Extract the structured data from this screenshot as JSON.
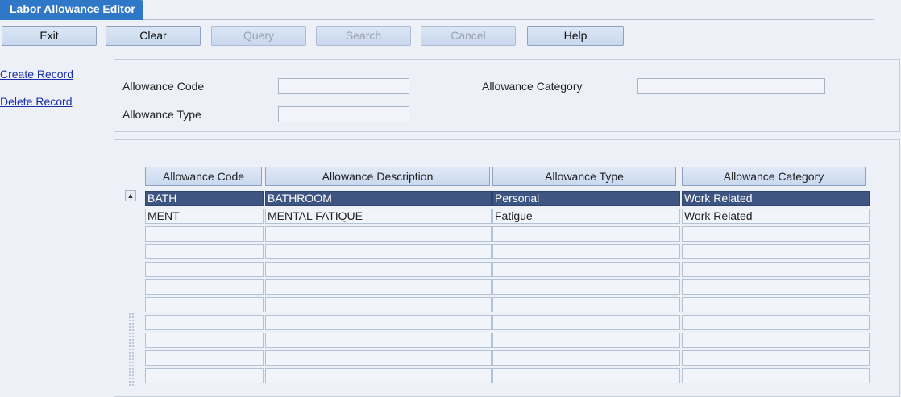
{
  "tab": {
    "title": "Labor Allowance Editor"
  },
  "toolbar": [
    {
      "label": "Exit",
      "enabled": true,
      "name": "exit-button"
    },
    {
      "label": "Clear",
      "enabled": true,
      "name": "clear-button"
    },
    {
      "label": "Query",
      "enabled": false,
      "name": "query-button"
    },
    {
      "label": "Search",
      "enabled": false,
      "name": "search-button"
    },
    {
      "label": "Cancel",
      "enabled": false,
      "name": "cancel-button"
    },
    {
      "label": "Help",
      "enabled": true,
      "name": "help-button"
    }
  ],
  "links": {
    "create": "Create Record",
    "delete": "Delete Record"
  },
  "filters": {
    "code_label": "Allowance Code",
    "code_value": "",
    "category_label": "Allowance Category",
    "category_value": "",
    "type_label": "Allowance Type",
    "type_value": ""
  },
  "table": {
    "columns": [
      "Allowance Code",
      "Allowance Description",
      "Allowance Type",
      "Allowance Category"
    ],
    "rows": [
      {
        "code": "BATH",
        "description": "BATHROOM",
        "type": "Personal",
        "category": "Work Related",
        "selected": true
      },
      {
        "code": "MENT",
        "description": "MENTAL FATIQUE",
        "type": "Fatigue",
        "category": "Work Related",
        "selected": false
      }
    ],
    "empty_rows": 9
  }
}
